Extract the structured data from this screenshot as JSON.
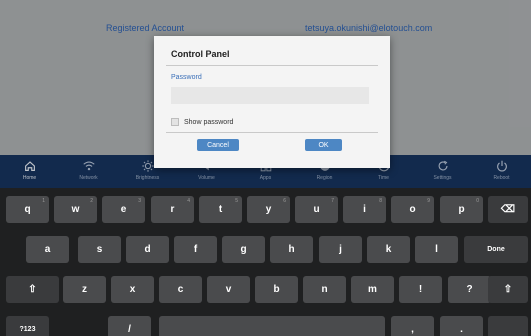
{
  "background": {
    "label": "Registered Account",
    "value": "tetsuya.okunishi@elotouch.com"
  },
  "dock": [
    {
      "label": "Home",
      "icon": "home-icon",
      "active": true
    },
    {
      "label": "Network",
      "icon": "wifi-icon"
    },
    {
      "label": "Brightness",
      "icon": "brightness-icon"
    },
    {
      "label": "Volume",
      "icon": "volume-icon"
    },
    {
      "label": "Apps",
      "icon": "apps-icon"
    },
    {
      "label": "Region",
      "icon": "globe-icon"
    },
    {
      "label": "Time",
      "icon": "clock-icon"
    },
    {
      "label": "Settings",
      "icon": "refresh-icon"
    },
    {
      "label": "Reboot",
      "icon": "power-icon"
    }
  ],
  "dialog": {
    "title": "Control Panel",
    "password_label": "Password",
    "password_value": "",
    "show_password_label": "Show password",
    "show_password_checked": false,
    "cancel_label": "Cancel",
    "ok_label": "OK"
  },
  "keyboard": {
    "rows": [
      [
        {
          "label": "q",
          "hint": "1"
        },
        {
          "label": "w",
          "hint": "2"
        },
        {
          "label": "e",
          "hint": "3"
        },
        {
          "label": "r",
          "hint": "4"
        },
        {
          "label": "t",
          "hint": "5"
        },
        {
          "label": "y",
          "hint": "6"
        },
        {
          "label": "u",
          "hint": "7"
        },
        {
          "label": "i",
          "hint": "8"
        },
        {
          "label": "o",
          "hint": "9"
        },
        {
          "label": "p",
          "hint": "0"
        },
        {
          "label": "⌫",
          "icon": "backspace-icon"
        }
      ],
      [
        {
          "label": "a"
        },
        {
          "label": "s"
        },
        {
          "label": "d"
        },
        {
          "label": "f"
        },
        {
          "label": "g"
        },
        {
          "label": "h"
        },
        {
          "label": "j"
        },
        {
          "label": "k"
        },
        {
          "label": "l"
        },
        {
          "label": "Done"
        }
      ],
      [
        {
          "label": "⇧",
          "icon": "shift-icon"
        },
        {
          "label": "z"
        },
        {
          "label": "x"
        },
        {
          "label": "c"
        },
        {
          "label": "v"
        },
        {
          "label": "b"
        },
        {
          "label": "n"
        },
        {
          "label": "m"
        },
        {
          "label": "!"
        },
        {
          "label": "?"
        },
        {
          "label": "⇧",
          "icon": "shift-icon"
        }
      ],
      [
        {
          "label": "?123"
        },
        {
          "label": "/"
        },
        {
          "label": ""
        },
        {
          "label": ","
        },
        {
          "label": "."
        },
        {
          "label": ""
        }
      ]
    ]
  }
}
